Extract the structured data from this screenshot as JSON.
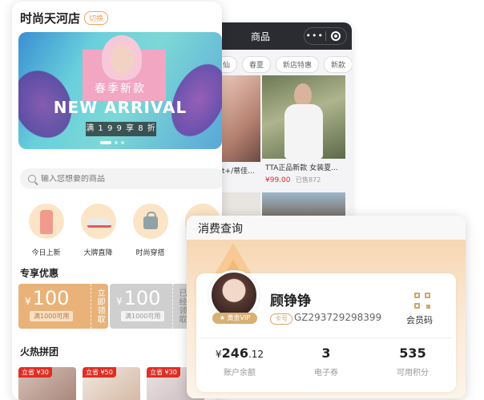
{
  "back_panel": {
    "title": "商品",
    "capsule_dots": "•••",
    "categories": [
      "仙",
      "春夏",
      "新店特惠",
      "新款"
    ],
    "products": {
      "left_title": "t+/蒂佳...",
      "right_title": "TTA正品新款 女装夏...",
      "right_price": "¥99.00",
      "right_sold": "已售872"
    }
  },
  "left_panel": {
    "shop_title": "时尚天河店",
    "switch_label": "切换",
    "banner": {
      "subtitle": "春季新款",
      "headline": "NEW ARRIVAL",
      "promo": "满 1 9 9 享 8 折"
    },
    "search": {
      "placeholder": "输入您想要的商品"
    },
    "categories": [
      {
        "label": "今日上新",
        "icon": "coat-icon"
      },
      {
        "label": "大牌直降",
        "icon": "sneaker-icon"
      },
      {
        "label": "时尚穿搭",
        "icon": "handbag-icon"
      }
    ],
    "coupons_title": "专享优惠",
    "coupons": [
      {
        "yen": "¥",
        "amount": "100",
        "condition": "满1000可用",
        "action": "立即领取"
      },
      {
        "yen": "¥",
        "amount": "100",
        "condition": "满1000可用",
        "action": "已经领取"
      }
    ],
    "group_title": "火热拼团",
    "group_tags": [
      "立省 ¥30",
      "立省 ¥50",
      "立省 ¥30"
    ]
  },
  "front_card": {
    "title": "消费查询",
    "member": {
      "name": "顾铮铮",
      "vip": "★ 黄金VIP",
      "card_label": "卡号",
      "card_number": "GZ293729298399",
      "qr_label": "会员码"
    },
    "stats": [
      {
        "currency": "¥",
        "value": "246",
        "decimal": ".12",
        "label": "账户余额"
      },
      {
        "currency": "",
        "value": "3",
        "decimal": "",
        "label": "电子券"
      },
      {
        "currency": "",
        "value": "535",
        "decimal": "",
        "label": "可用积分"
      }
    ]
  }
}
